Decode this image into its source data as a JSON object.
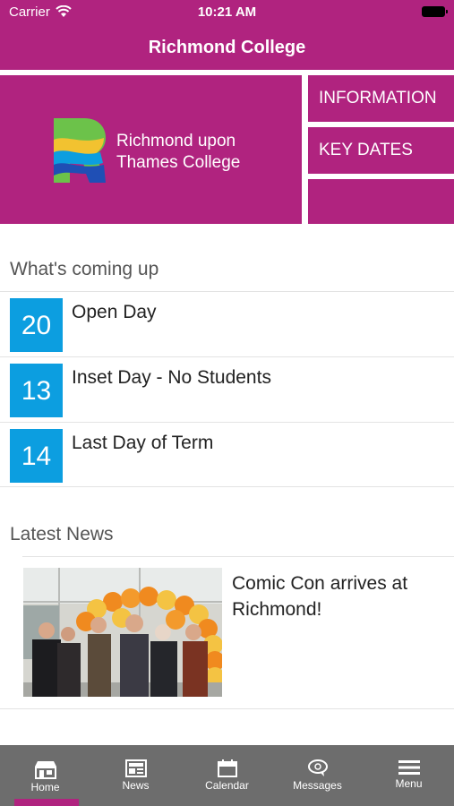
{
  "status_bar": {
    "carrier": "Carrier",
    "time": "10:21 AM"
  },
  "header": {
    "title": "Richmond College"
  },
  "hero": {
    "logo_line1": "Richmond upon",
    "logo_line2": "Thames College",
    "tiles": [
      "INFORMATION",
      "KEY DATES"
    ]
  },
  "coming_up": {
    "title": "What's coming up",
    "events": [
      {
        "day": "20",
        "title": "Open Day"
      },
      {
        "day": "13",
        "title": "Inset Day - No Students"
      },
      {
        "day": "14",
        "title": "Last Day of Term"
      }
    ]
  },
  "news": {
    "title": "Latest News",
    "items": [
      {
        "headline": "Comic Con arrives at Richmond!"
      }
    ]
  },
  "tab_bar": {
    "tabs": [
      {
        "label": "Home",
        "icon": "home-icon"
      },
      {
        "label": "News",
        "icon": "news-icon"
      },
      {
        "label": "Calendar",
        "icon": "calendar-icon"
      },
      {
        "label": "Messages",
        "icon": "messages-icon"
      },
      {
        "label": "Menu",
        "icon": "menu-icon"
      }
    ],
    "active": "Home"
  },
  "colors": {
    "brand": "#b0237f",
    "date_box": "#0c9ee0",
    "tab_bar": "#6d6d6d"
  }
}
